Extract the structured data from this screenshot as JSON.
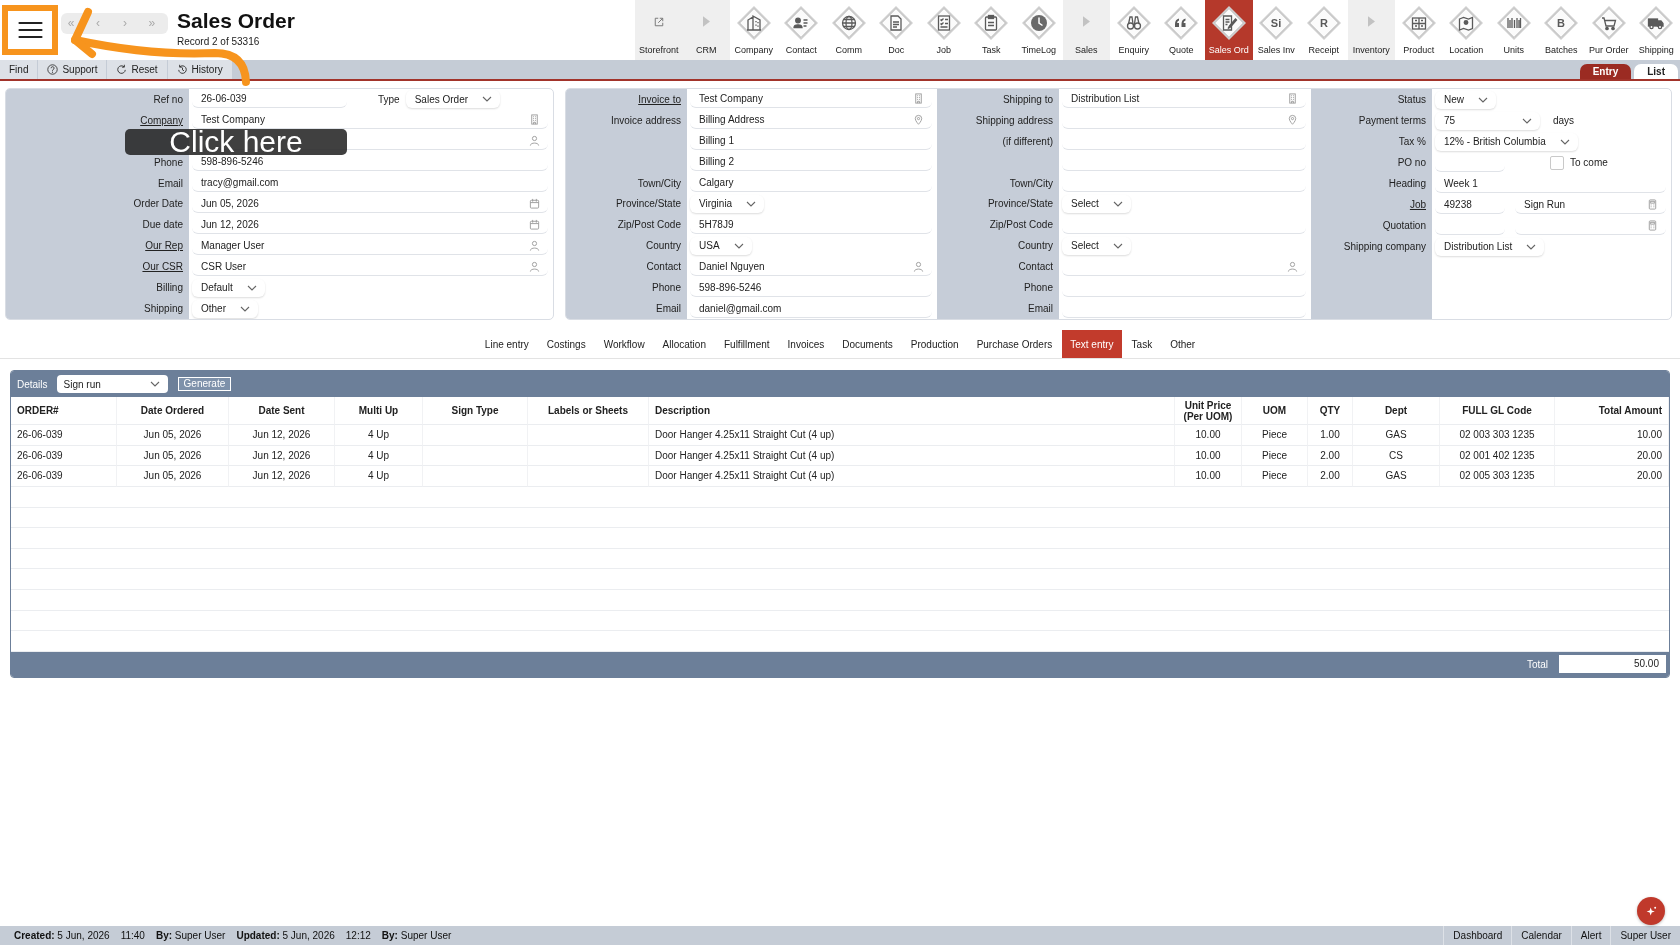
{
  "header": {
    "nav": [
      "«",
      "‹",
      "›",
      "»"
    ],
    "title": "Sales Order",
    "record": "Record 2 of 53316"
  },
  "modules": [
    {
      "label": "Storefront",
      "kind": "link",
      "selected": false
    },
    {
      "label": "CRM",
      "kind": "group",
      "selected": false
    },
    {
      "label": "Company",
      "kind": "module",
      "selected": false
    },
    {
      "label": "Contact",
      "kind": "module",
      "selected": false
    },
    {
      "label": "Comm",
      "kind": "module",
      "selected": false
    },
    {
      "label": "Doc",
      "kind": "module",
      "selected": false
    },
    {
      "label": "Job",
      "kind": "module",
      "selected": false
    },
    {
      "label": "Task",
      "kind": "module",
      "selected": false
    },
    {
      "label": "TimeLog",
      "kind": "module",
      "selected": false
    },
    {
      "label": "Sales",
      "kind": "group",
      "selected": false
    },
    {
      "label": "Enquiry",
      "kind": "module",
      "selected": false
    },
    {
      "label": "Quote",
      "kind": "module",
      "selected": false
    },
    {
      "label": "Sales Ord",
      "kind": "module",
      "selected": true
    },
    {
      "label": "Sales Inv",
      "kind": "module",
      "glyph": "Si",
      "selected": false
    },
    {
      "label": "Receipt",
      "kind": "module",
      "glyph": "R",
      "selected": false
    },
    {
      "label": "Inventory",
      "kind": "group",
      "selected": false
    },
    {
      "label": "Product",
      "kind": "module",
      "selected": false
    },
    {
      "label": "Location",
      "kind": "module",
      "selected": false
    },
    {
      "label": "Units",
      "kind": "module",
      "selected": false
    },
    {
      "label": "Batches",
      "kind": "module",
      "glyph": "B",
      "selected": false
    },
    {
      "label": "Pur Order",
      "kind": "module",
      "selected": false
    },
    {
      "label": "Shipping",
      "kind": "module",
      "selected": false
    }
  ],
  "actions": [
    {
      "label": "Find",
      "kind": "plain"
    },
    {
      "label": "Support",
      "kind": "help"
    },
    {
      "label": "Reset",
      "kind": "reset"
    },
    {
      "label": "History",
      "kind": "history"
    }
  ],
  "view_tabs": [
    {
      "label": "Entry",
      "selected": true
    },
    {
      "label": "List",
      "selected": false
    }
  ],
  "panels": [
    {
      "columns": [
        {
          "rows": [
            {
              "label": "Ref no",
              "link": false,
              "fields": [
                {
                  "kind": "text",
                  "value": "26-06-039"
                },
                {
                  "kind": "label",
                  "value": "Type"
                },
                {
                  "kind": "select",
                  "value": "Sales Order"
                }
              ]
            },
            {
              "label": "Company",
              "link": true,
              "fields": [
                {
                  "kind": "company",
                  "value": "Test Company"
                }
              ]
            },
            {
              "fields": [
                {
                  "kind": "person"
                }
              ]
            },
            {
              "label": "Phone",
              "link": false,
              "fields": [
                {
                  "kind": "text",
                  "value": "598-896-5246"
                }
              ]
            },
            {
              "label": "Email",
              "link": false,
              "fields": [
                {
                  "kind": "text",
                  "value": "tracy@gmail.com"
                }
              ]
            },
            {
              "label": "Order Date",
              "link": false,
              "fields": [
                {
                  "kind": "date",
                  "value": "Jun 05, 2026"
                }
              ]
            },
            {
              "label": "Due date",
              "link": false,
              "fields": [
                {
                  "kind": "date",
                  "value": "Jun 12, 2026"
                }
              ]
            },
            {
              "label": "Our Rep",
              "link": true,
              "fields": [
                {
                  "kind": "person",
                  "value": "Manager User"
                }
              ]
            },
            {
              "label": "Our CSR",
              "link": true,
              "fields": [
                {
                  "kind": "person",
                  "value": "CSR User"
                }
              ]
            },
            {
              "label": "Billing",
              "link": false,
              "fields": [
                {
                  "kind": "select",
                  "value": "Default"
                }
              ]
            },
            {
              "label": "Shipping",
              "link": false,
              "fields": [
                {
                  "kind": "select",
                  "value": "Other"
                }
              ]
            }
          ]
        }
      ]
    },
    {
      "columns": [
        {
          "rows": [
            {
              "label": "Invoice to",
              "link": true,
              "fields": [
                {
                  "kind": "company",
                  "value": "Test Company"
                }
              ]
            },
            {
              "label": "Invoice address",
              "link": false,
              "fields": [
                {
                  "kind": "address",
                  "value": "Billing Address"
                }
              ]
            },
            {
              "fields": [
                {
                  "kind": "text",
                  "value": "Billing 1"
                }
              ]
            },
            {
              "fields": [
                {
                  "kind": "text",
                  "value": "Billing 2"
                }
              ]
            },
            {
              "label": "Town/City",
              "link": false,
              "fields": [
                {
                  "kind": "text",
                  "value": "Calgary"
                }
              ]
            },
            {
              "label": "Province/State",
              "link": false,
              "fields": [
                {
                  "kind": "select",
                  "value": "Virginia"
                }
              ]
            },
            {
              "label": "Zip/Post Code",
              "link": false,
              "fields": [
                {
                  "kind": "text",
                  "value": "5H78J9"
                }
              ]
            },
            {
              "label": "Country",
              "link": false,
              "fields": [
                {
                  "kind": "select",
                  "value": "USA"
                }
              ]
            },
            {
              "label": "Contact",
              "link": false,
              "fields": [
                {
                  "kind": "person",
                  "value": "Daniel Nguyen"
                }
              ]
            },
            {
              "label": "Phone",
              "link": false,
              "fields": [
                {
                  "kind": "text",
                  "value": "598-896-5246"
                }
              ]
            },
            {
              "label": "Email",
              "link": false,
              "fields": [
                {
                  "kind": "text",
                  "value": "daniel@gmail.com"
                }
              ]
            }
          ]
        },
        {
          "rows": [
            {
              "label": "Shipping to",
              "link": false,
              "fields": [
                {
                  "kind": "company",
                  "value": "Distribution List"
                }
              ]
            },
            {
              "label": "Shipping address",
              "link": false,
              "fields": [
                {
                  "kind": "address"
                }
              ]
            },
            {
              "label": "(if different)",
              "link": false,
              "fields": [
                {
                  "kind": "text"
                }
              ]
            },
            {
              "fields": [
                {
                  "kind": "text"
                }
              ]
            },
            {
              "label": "Town/City",
              "link": false,
              "fields": [
                {
                  "kind": "text"
                }
              ]
            },
            {
              "label": "Province/State",
              "link": false,
              "fields": [
                {
                  "kind": "select",
                  "value": "Select"
                }
              ]
            },
            {
              "label": "Zip/Post Code",
              "link": false,
              "fields": [
                {
                  "kind": "text"
                }
              ]
            },
            {
              "label": "Country",
              "link": false,
              "fields": [
                {
                  "kind": "select",
                  "value": "Select"
                }
              ]
            },
            {
              "label": "Contact",
              "link": false,
              "fields": [
                {
                  "kind": "person"
                }
              ]
            },
            {
              "label": "Phone",
              "link": false,
              "fields": [
                {
                  "kind": "text"
                }
              ]
            },
            {
              "label": "Email",
              "link": false,
              "fields": [
                {
                  "kind": "text"
                }
              ]
            }
          ]
        },
        {
          "rows": [
            {
              "label": "Status",
              "link": false,
              "fields": [
                {
                  "kind": "select",
                  "value": "New"
                }
              ]
            },
            {
              "label": "Payment terms",
              "link": false,
              "fields": [
                {
                  "kind": "select",
                  "value": "75"
                },
                {
                  "kind": "suffix",
                  "value": "days"
                }
              ]
            },
            {
              "label": "Tax %",
              "link": false,
              "fields": [
                {
                  "kind": "select",
                  "value": "12% - British Columbia"
                }
              ]
            },
            {
              "label": "PO no",
              "link": false,
              "fields": [
                {
                  "kind": "text"
                },
                {
                  "kind": "checkbox",
                  "label": "To come",
                  "checked": false
                }
              ]
            },
            {
              "label": "Heading",
              "link": false,
              "fields": [
                {
                  "kind": "text",
                  "value": "Week 1"
                }
              ]
            },
            {
              "label": "Job",
              "link": true,
              "fields": [
                {
                  "kind": "text",
                  "value": "49238"
                },
                {
                  "kind": "lookup",
                  "value": "Sign Run"
                }
              ]
            },
            {
              "label": "Quotation",
              "link": false,
              "fields": [
                {
                  "kind": "text"
                },
                {
                  "kind": "lookup"
                }
              ]
            },
            {
              "label": "Shipping company",
              "link": false,
              "fields": [
                {
                  "kind": "select",
                  "value": "Distribution List"
                }
              ]
            }
          ]
        }
      ]
    }
  ],
  "detail_tabs": [
    {
      "label": "Line entry",
      "selected": false
    },
    {
      "label": "Costings",
      "selected": false
    },
    {
      "label": "Workflow",
      "selected": false
    },
    {
      "label": "Allocation",
      "selected": false
    },
    {
      "label": "Fulfillment",
      "selected": false
    },
    {
      "label": "Invoices",
      "selected": false
    },
    {
      "label": "Documents",
      "selected": false
    },
    {
      "label": "Production",
      "selected": false
    },
    {
      "label": "Purchase Orders",
      "selected": false
    },
    {
      "label": "Text entry",
      "selected": true
    },
    {
      "label": "Task",
      "selected": false
    },
    {
      "label": "Other",
      "selected": false
    }
  ],
  "details": {
    "title": "Details",
    "mode": "Sign run",
    "action": "Generate",
    "columns": [
      "ORDER#",
      "Date Ordered",
      "Date Sent",
      "Multi Up",
      "Sign Type",
      "Labels or Sheets",
      "Description",
      "Unit Price (Per UOM)",
      "UOM",
      "QTY",
      "Dept",
      "FULL GL Code",
      "Total Amount"
    ],
    "rows": [
      [
        "26-06-039",
        "Jun 05, 2026",
        "Jun 12, 2026",
        "4 Up",
        null,
        null,
        "Door Hanger 4.25x11 Straight Cut (4 up)",
        "10.00",
        "Piece",
        "1.00",
        "GAS",
        "02 003 303 1235",
        "10.00"
      ],
      [
        "26-06-039",
        "Jun 05, 2026",
        "Jun 12, 2026",
        "4 Up",
        null,
        null,
        "Door Hanger 4.25x11 Straight Cut (4 up)",
        "10.00",
        "Piece",
        "2.00",
        "CS",
        "02 001 402 1235",
        "20.00"
      ],
      [
        "26-06-039",
        "Jun 05, 2026",
        "Jun 12, 2026",
        "4 Up",
        null,
        null,
        "Door Hanger 4.25x11 Straight Cut (4 up)",
        "10.00",
        "Piece",
        "2.00",
        "GAS",
        "02 005 303 1235",
        "20.00"
      ]
    ],
    "total_label": "Total",
    "total": "50.00"
  },
  "status_bar": {
    "audit": [
      "**Created:** 5 Jun, 2026",
      "11:40",
      "**By:** Super User",
      "**Updated:** 5 Jun, 2026",
      "12:12",
      "**By:** Super User"
    ],
    "links": [
      "Dashboard",
      "Calendar",
      "Alert",
      "Super User"
    ]
  },
  "tutorial": {
    "callout": "Click here"
  }
}
